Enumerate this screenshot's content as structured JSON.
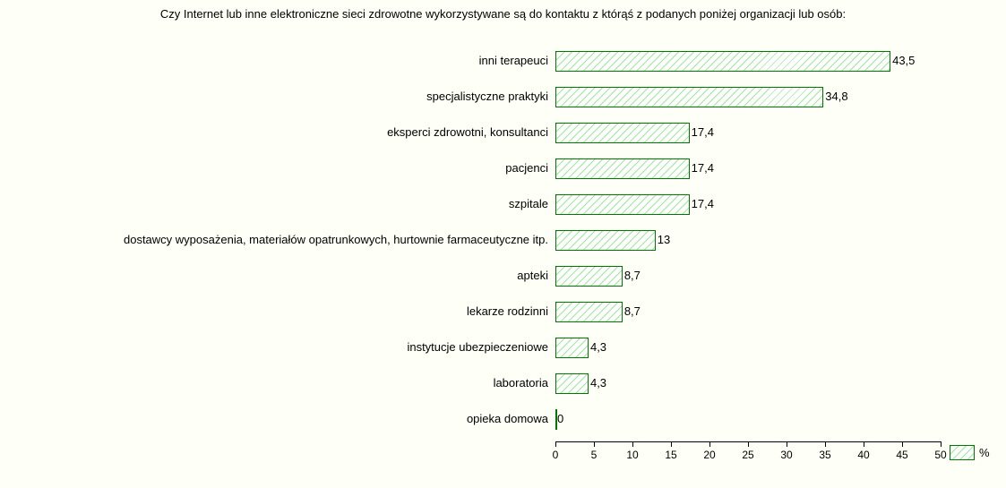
{
  "chart_data": {
    "type": "bar",
    "title": "Czy Internet lub inne elektroniczne sieci zdrowotne wykorzystywane są do kontaktu z którąś z podanych poniżej organizacji lub osób:",
    "categories": [
      "inni terapeuci",
      "specjalistyczne praktyki",
      "eksperci zdrowotni, konsultanci",
      "pacjenci",
      "szpitale",
      "dostawcy wyposażenia, materiałów opatrunkowych, hurtownie farmaceutyczne itp.",
      "apteki",
      "lekarze rodzinni",
      "instytucje ubezpieczeniowe",
      "laboratoria",
      "opieka domowa"
    ],
    "values": [
      43.5,
      34.8,
      17.4,
      17.4,
      17.4,
      13,
      8.7,
      8.7,
      4.3,
      4.3,
      0
    ],
    "value_labels": [
      "43,5",
      "34,8",
      "17,4",
      "17,4",
      "17,4",
      "13",
      "8,7",
      "8,7",
      "4,3",
      "4,3",
      "0"
    ],
    "xlim": [
      0,
      50
    ],
    "x_ticks": [
      0,
      5,
      10,
      15,
      20,
      25,
      30,
      35,
      40,
      45,
      50
    ],
    "x_tick_labels": [
      "0",
      "5",
      "10",
      "15",
      "20",
      "25",
      "30",
      "35",
      "40",
      "45",
      "50"
    ],
    "legend_label": "%"
  }
}
